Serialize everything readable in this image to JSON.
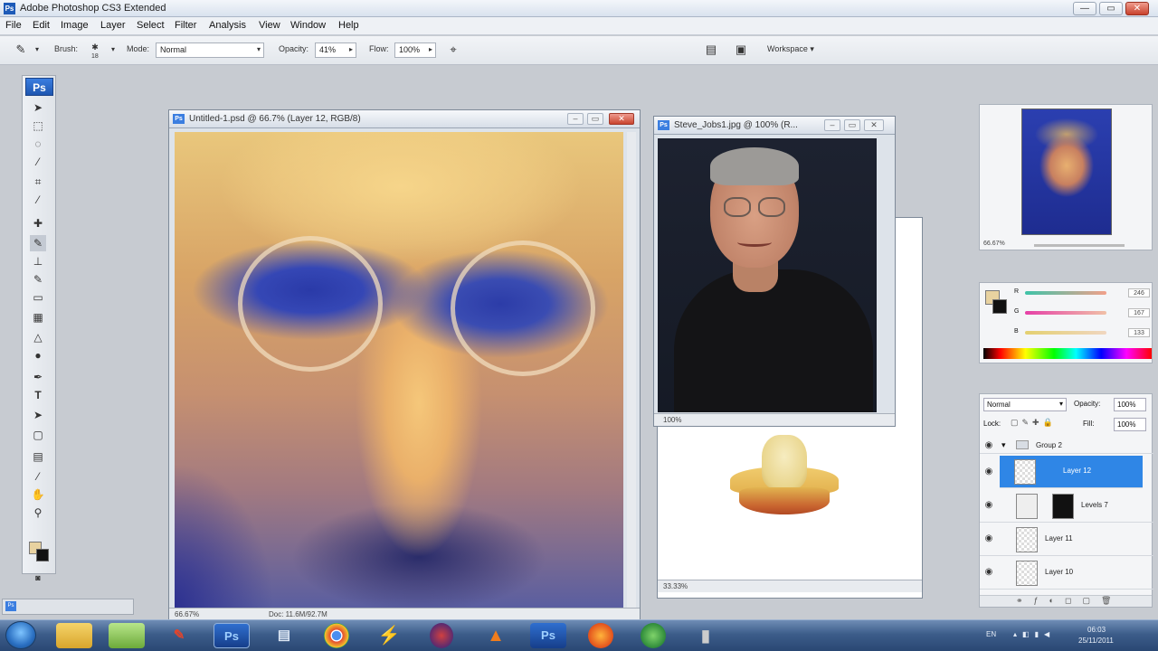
{
  "app": {
    "title": "Adobe Photoshop CS3 Extended",
    "logo": "Ps"
  },
  "window_controls": {
    "minimize": "—",
    "maximize": "▭",
    "close": "✕"
  },
  "menu": [
    "File",
    "Edit",
    "Image",
    "Layer",
    "Select",
    "Filter",
    "Analysis",
    "View",
    "Window",
    "Help"
  ],
  "options_bar": {
    "brush_label": "Brush:",
    "brush_size": "18",
    "mode_label": "Mode:",
    "mode_value": "Normal",
    "opacity_label": "Opacity:",
    "opacity_value": "41%",
    "flow_label": "Flow:",
    "flow_value": "100%",
    "workspace_label": "Workspace ▾"
  },
  "doc_main": {
    "title": "Untitled-1.psd @ 66.7% (Layer 12, RGB/8)",
    "zoom": "66.67%",
    "doc_info": "Doc: 11.6M/92.7M"
  },
  "doc_ref": {
    "title": "Steve_Jobs1.jpg @ 100% (R...",
    "zoom": "100%"
  },
  "doc_apple": {
    "zoom": "33.33%"
  },
  "navigator": {
    "zoom": "66.67%"
  },
  "color_panel": {
    "r_label": "R",
    "g_label": "G",
    "b_label": "B",
    "r_value": "246",
    "g_value": "167",
    "b_value": "133"
  },
  "layers_panel": {
    "blend_mode": "Normal",
    "opacity_label": "Opacity:",
    "opacity_value": "100%",
    "lock_label": "Lock:",
    "fill_label": "Fill:",
    "fill_value": "100%",
    "group": "Group 2",
    "layers": [
      {
        "name": "Layer 12",
        "selected": true
      },
      {
        "name": "Levels 7",
        "selected": false
      },
      {
        "name": "Layer 11",
        "selected": false
      },
      {
        "name": "Layer 10",
        "selected": false
      }
    ]
  },
  "taskbar": {
    "apps": [
      "explorer-icon",
      "folder-icon",
      "paint-icon",
      "photoshop-icon",
      "document-icon",
      "chrome-icon",
      "flash-icon",
      "burn-icon",
      "vlc-icon",
      "photoshop-icon",
      "firefox-icon",
      "globe-icon",
      "unknown-icon"
    ],
    "ps_label": "Ps",
    "lang": "EN",
    "time": "06:03",
    "date": "25/11/2011"
  }
}
